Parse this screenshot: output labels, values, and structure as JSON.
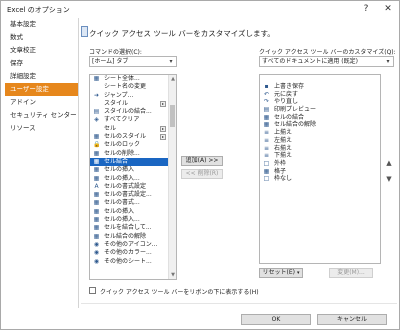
{
  "window": {
    "title": "Excel のオプション",
    "help_glyph": "?",
    "close_glyph": "✕"
  },
  "sidebar": {
    "items": [
      {
        "label": "基本設定"
      },
      {
        "label": "数式"
      },
      {
        "label": "文章校正"
      },
      {
        "label": "保存"
      },
      {
        "label": "詳細設定"
      },
      {
        "label": "ユーザー設定"
      },
      {
        "label": "アドイン"
      },
      {
        "label": "セキュリティ センター"
      },
      {
        "label": "リソース"
      }
    ],
    "selected_index": 5
  },
  "main": {
    "heading": "クイック アクセス ツール バーをカスタマイズします。",
    "commands_label": "コマンドの選択(C):",
    "commands_value": "[ホーム] タブ",
    "customize_label": "クイック アクセス ツール バーのカスタマイズ(Q):",
    "customize_value": "すべてのドキュメントに適用 (既定)",
    "add_button": "追加(A) >>",
    "remove_button": "<< 削除(R)",
    "reset_button": "リセット(E)",
    "modify_button": "変更(M)...",
    "show_below_label": "クイック アクセス ツール バーをリボンの下に表示する(H)",
    "ok_button": "OK",
    "cancel_button": "キャンセル"
  },
  "left_list": [
    {
      "label": "シート全体...",
      "icon": "▦"
    },
    {
      "label": "シート名の変更",
      "icon": ""
    },
    {
      "label": "ジャンプ...",
      "icon": "➜"
    },
    {
      "label": "スタイル",
      "icon": "",
      "submenu": true
    },
    {
      "label": "スタイルの結合...",
      "icon": "▤"
    },
    {
      "label": "すべてクリア",
      "icon": "◈"
    },
    {
      "label": "セル",
      "icon": "",
      "submenu": true
    },
    {
      "label": "セルのスタイル",
      "icon": "▦",
      "submenu": true
    },
    {
      "label": "セルのロック",
      "icon": "🔒"
    },
    {
      "label": "セルの削除...",
      "icon": "▦"
    },
    {
      "label": "セル結合",
      "icon": "▦",
      "selected": true
    },
    {
      "label": "セルの挿入",
      "icon": "▦"
    },
    {
      "label": "セルの挿入...",
      "icon": "▦"
    },
    {
      "label": "セルの書式設定",
      "icon": "A"
    },
    {
      "label": "セルの書式設定...",
      "icon": "▦"
    },
    {
      "label": "セルの書式...",
      "icon": "▦"
    },
    {
      "label": "セルの挿入",
      "icon": "▦"
    },
    {
      "label": "セルの挿入...",
      "icon": "▦"
    },
    {
      "label": "セルを結合して...",
      "icon": "▦"
    },
    {
      "label": "セル結合の解除",
      "icon": "▦"
    },
    {
      "label": "その他のアイコン...",
      "icon": "◉"
    },
    {
      "label": "その他のカラー...",
      "icon": "◉"
    },
    {
      "label": "その他のシート...",
      "icon": "◉"
    }
  ],
  "right_list": [
    {
      "label": "上書き保存",
      "icon": "▪"
    },
    {
      "label": "元に戻す",
      "icon": "↶"
    },
    {
      "label": "やり直し",
      "icon": "↷"
    },
    {
      "label": "印刷プレビュー",
      "icon": "▤"
    },
    {
      "label": "セルの結合",
      "icon": "▦"
    },
    {
      "label": "セル結合の解除",
      "icon": "▦"
    },
    {
      "label": "上揃え",
      "icon": "≡"
    },
    {
      "label": "左揃え",
      "icon": "≡"
    },
    {
      "label": "右揃え",
      "icon": "≡"
    },
    {
      "label": "下揃え",
      "icon": "≡"
    },
    {
      "label": "外枠",
      "icon": "□"
    },
    {
      "label": "格子",
      "icon": "▦"
    },
    {
      "label": "枠なし",
      "icon": "□"
    }
  ]
}
